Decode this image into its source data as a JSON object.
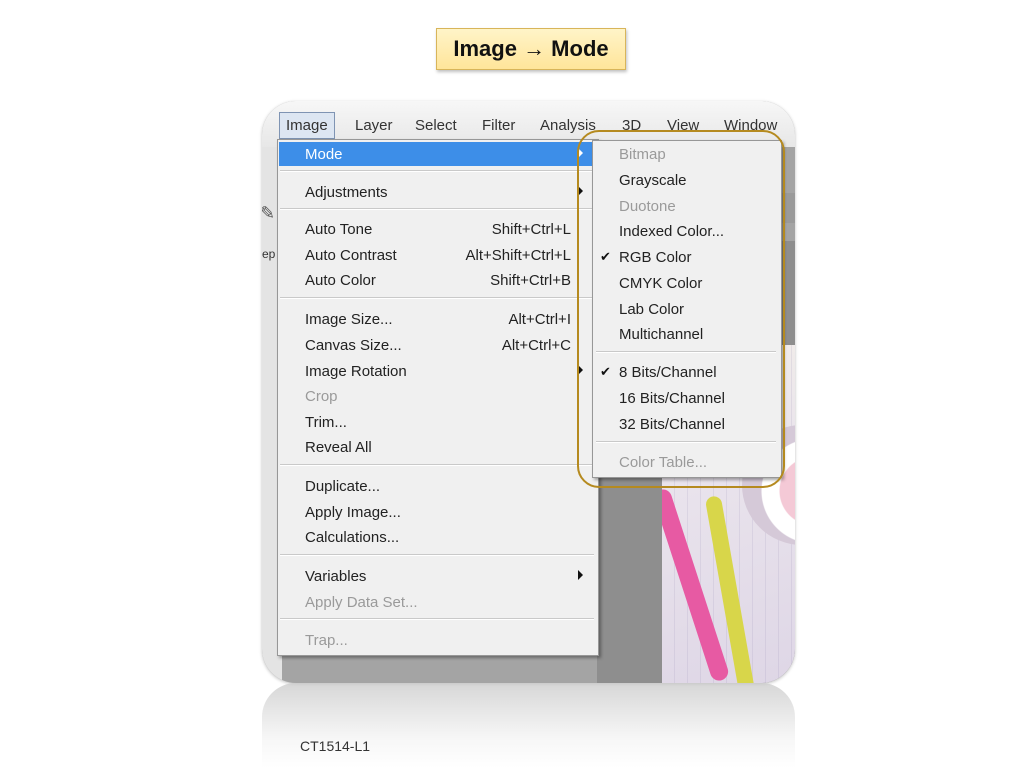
{
  "slide_title": "Image → Mode",
  "footer": "CT1514-L1",
  "colors": {
    "highlight": "#3d8ee8",
    "callout_border": "#b58a1f",
    "title_box": "#ffe59a"
  },
  "menubar": {
    "items": [
      "Image",
      "Layer",
      "Select",
      "Filter",
      "Analysis",
      "3D",
      "View",
      "Window"
    ],
    "active": "Image"
  },
  "side_strip": {
    "label": "ep"
  },
  "image_menu": {
    "items": [
      {
        "label": "Mode",
        "submenu": true,
        "highlighted": true
      },
      {
        "label": "Adjustments",
        "submenu": true
      },
      {
        "label": "Auto Tone",
        "shortcut": "Shift+Ctrl+L"
      },
      {
        "label": "Auto Contrast",
        "shortcut": "Alt+Shift+Ctrl+L"
      },
      {
        "label": "Auto Color",
        "shortcut": "Shift+Ctrl+B"
      },
      {
        "label": "Image Size...",
        "shortcut": "Alt+Ctrl+I"
      },
      {
        "label": "Canvas Size...",
        "shortcut": "Alt+Ctrl+C"
      },
      {
        "label": "Image Rotation",
        "submenu": true
      },
      {
        "label": "Crop",
        "disabled": true
      },
      {
        "label": "Trim..."
      },
      {
        "label": "Reveal All"
      },
      {
        "label": "Duplicate..."
      },
      {
        "label": "Apply Image..."
      },
      {
        "label": "Calculations..."
      },
      {
        "label": "Variables",
        "submenu": true
      },
      {
        "label": "Apply Data Set...",
        "disabled": true
      },
      {
        "label": "Trap...",
        "disabled": true
      }
    ]
  },
  "mode_submenu": {
    "items": [
      {
        "label": "Bitmap",
        "disabled": true
      },
      {
        "label": "Grayscale"
      },
      {
        "label": "Duotone",
        "disabled": true
      },
      {
        "label": "Indexed Color..."
      },
      {
        "label": "RGB Color",
        "checked": true
      },
      {
        "label": "CMYK Color"
      },
      {
        "label": "Lab Color"
      },
      {
        "label": "Multichannel"
      },
      {
        "label": "8 Bits/Channel",
        "checked": true
      },
      {
        "label": "16 Bits/Channel"
      },
      {
        "label": "32 Bits/Channel"
      },
      {
        "label": "Color Table...",
        "disabled": true
      }
    ]
  }
}
